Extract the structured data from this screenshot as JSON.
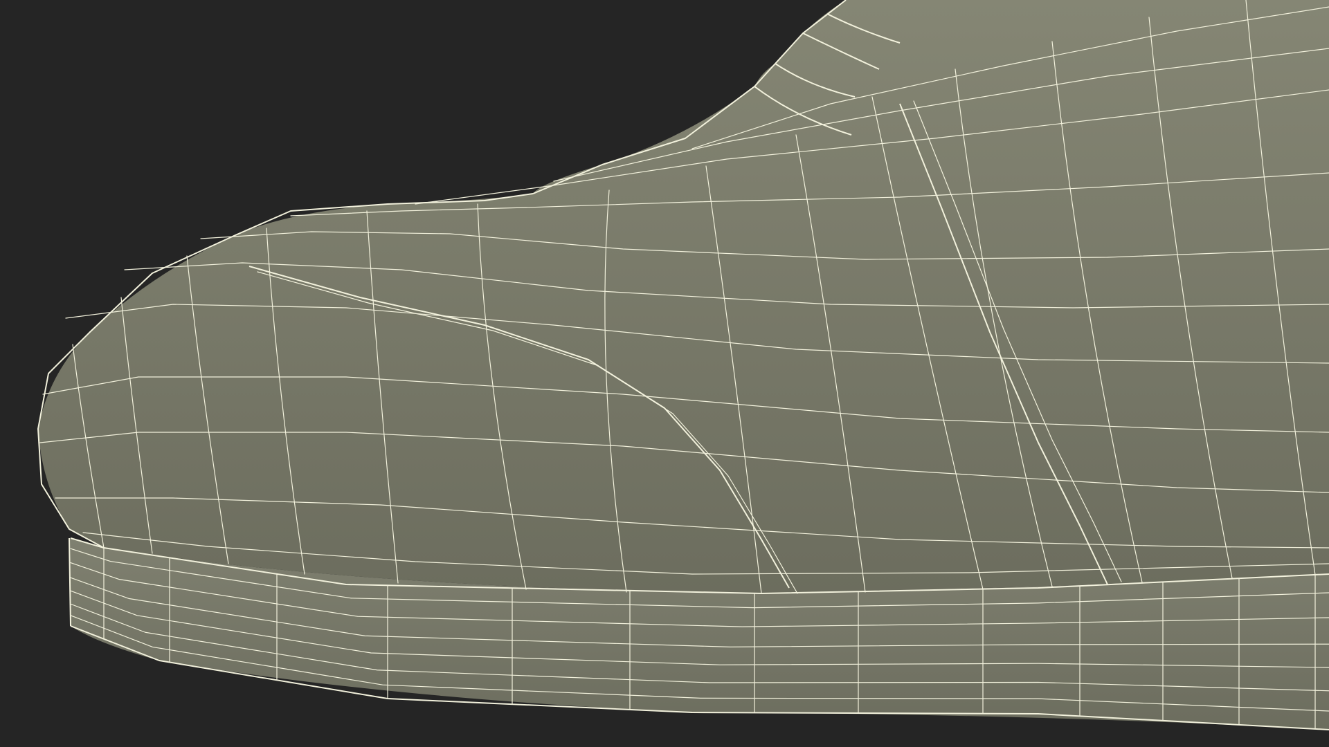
{
  "scene": {
    "subject": "shoe-toe-wireframe",
    "view": "side-closeup",
    "background_color": "#252525",
    "mesh_fill_color": "#858674",
    "mesh_shadow_color": "#6c6d5e",
    "sole_fill_color": "#7f8070",
    "wire_color": "#f2f1dc"
  }
}
